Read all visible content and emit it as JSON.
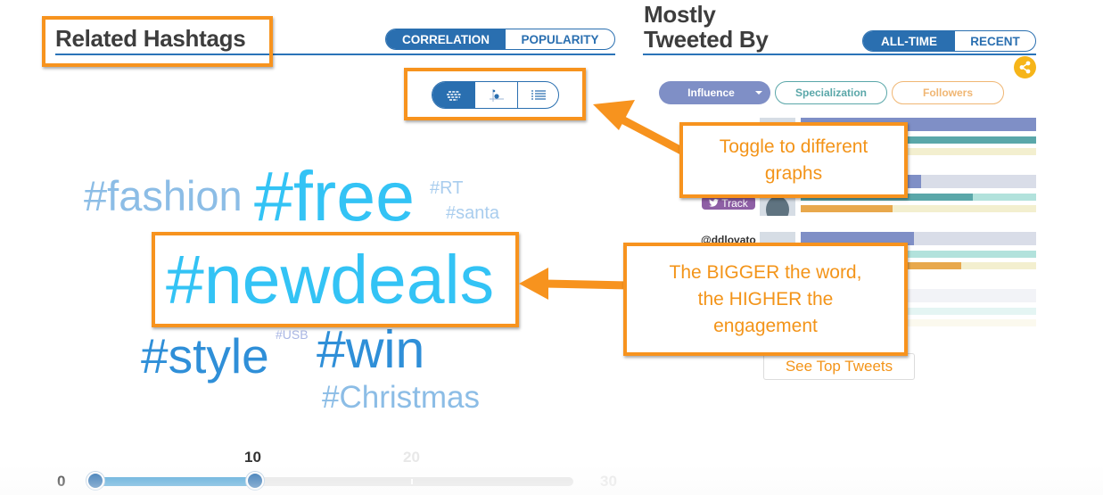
{
  "hashtags_panel": {
    "title": "Related Hashtags",
    "mode_toggle": [
      {
        "label": "CORRELATION",
        "active": true
      },
      {
        "label": "POPULARITY",
        "active": false
      }
    ],
    "graph_toggle": [
      {
        "icon": "word-cloud-icon",
        "active": true
      },
      {
        "icon": "scatter-plot-icon",
        "active": false
      },
      {
        "icon": "list-view-icon",
        "active": false
      }
    ],
    "word_cloud": [
      {
        "text": "#fashion",
        "color": "#8cbde6"
      },
      {
        "text": "#free",
        "color": "#33c3f5"
      },
      {
        "text": "#RT",
        "color": "#a9cdee"
      },
      {
        "text": "#santa",
        "color": "#a9cdee"
      },
      {
        "text": "#newdeals",
        "color": "#33c3f5"
      },
      {
        "text": "#style",
        "color": "#2f8fd8"
      },
      {
        "text": "#USB",
        "color": "#a9b6e4"
      },
      {
        "text": "#win",
        "color": "#2f8fd8"
      },
      {
        "text": "#Christmas",
        "color": "#8cbde6"
      }
    ],
    "range_slider": {
      "min": 0,
      "max": 30,
      "low": 0,
      "high": 10,
      "tick_labels": [
        "0",
        "10",
        "20",
        "30"
      ]
    }
  },
  "tweeted_by_panel": {
    "title_line1": "Mostly",
    "title_line2": "Tweeted By",
    "time_toggle": [
      {
        "label": "ALL-TIME",
        "active": true
      },
      {
        "label": "RECENT",
        "active": false
      }
    ],
    "share_icon": "share-icon",
    "metric_pills": [
      {
        "label": "Influence",
        "active": true,
        "has_dropdown": true
      },
      {
        "label": "Specialization",
        "active": false
      },
      {
        "label": "Followers",
        "active": false
      }
    ],
    "track_label": "Track",
    "visible_handle": "@ddlovato",
    "users": [
      {
        "influence": 1.0,
        "specialization": 1.0,
        "followers": 0.0
      },
      {
        "influence": 0.51,
        "specialization": 0.73,
        "followers": 0.39
      },
      {
        "influence": 0.48,
        "specialization": 0.0,
        "followers": 0.68
      },
      {
        "influence": 0.0,
        "specialization": 0.0,
        "followers": 0.0
      }
    ],
    "see_top_tweets": "See Top Tweets"
  },
  "colors": {
    "primary": "#2a6fb0",
    "influence": "#7f8fc6",
    "specialization": "#5aa7a9",
    "followers": "#e8a84c",
    "annotation": "#f7931e"
  },
  "annotations": {
    "toggle_note": "Toggle to different graphs",
    "size_note_line1": "The BIGGER the word,",
    "size_note_line2": "the HIGHER the",
    "size_note_line3": "engagement"
  }
}
